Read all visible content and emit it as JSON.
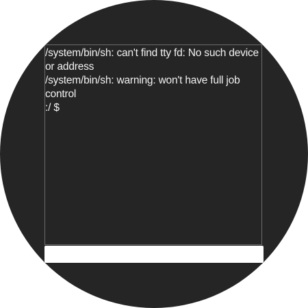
{
  "terminal": {
    "lines": [
      "/system/bin/sh: can't find tty fd: No such device",
      "or address",
      "/system/bin/sh: warning: won't have full job",
      "control",
      ":/ $"
    ]
  },
  "input": {
    "value": "",
    "placeholder": ""
  },
  "colors": {
    "background": "#252525",
    "text": "#f2f2f2",
    "frame_border": "#6b6b6b",
    "input_background": "#ffffff"
  }
}
